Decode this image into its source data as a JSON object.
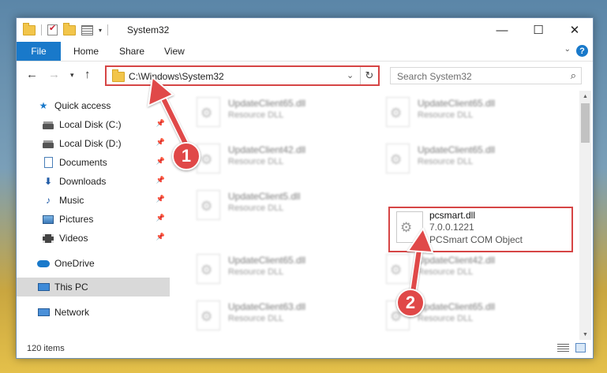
{
  "window": {
    "title": "System32",
    "controls": {
      "minimize": "—",
      "maximize": "☐",
      "close": "✕"
    }
  },
  "ribbon": {
    "tabs": [
      "File",
      "Home",
      "Share",
      "View"
    ],
    "help": "?"
  },
  "address": {
    "path": "C:\\Windows\\System32",
    "search_placeholder": "Search System32"
  },
  "sidebar": {
    "quick_access": "Quick access",
    "items": [
      {
        "label": "Local Disk (C:)",
        "icon": "drive-icon",
        "pinned": true
      },
      {
        "label": "Local Disk (D:)",
        "icon": "drive-icon",
        "pinned": true
      },
      {
        "label": "Documents",
        "icon": "documents-icon",
        "pinned": true
      },
      {
        "label": "Downloads",
        "icon": "downloads-icon",
        "pinned": true
      },
      {
        "label": "Music",
        "icon": "music-icon",
        "pinned": true
      },
      {
        "label": "Pictures",
        "icon": "pictures-icon",
        "pinned": true
      },
      {
        "label": "Videos",
        "icon": "videos-icon",
        "pinned": true
      }
    ],
    "onedrive": "OneDrive",
    "this_pc": "This PC",
    "network": "Network"
  },
  "files": [
    {
      "name": "UpdateClient65.dll",
      "type": "Resource DLL"
    },
    {
      "name": "UpdateClient65.dll",
      "type": "Resource DLL"
    },
    {
      "name": "UpdateClient42.dll",
      "type": "Resource DLL"
    },
    {
      "name": "UpdateClient65.dll",
      "type": "Resource DLL"
    },
    {
      "name": "UpdateClient5.dll",
      "type": "Resource DLL"
    },
    {
      "name": "UpdateClient65.dll",
      "type": "Resource DLL"
    },
    {
      "name": "UpdateClient42.dll",
      "type": "Resource DLL"
    },
    {
      "name": "UpdateClient63.dll",
      "type": "Resource DLL"
    },
    {
      "name": "UpdateClient65.dll",
      "type": "Resource DLL"
    }
  ],
  "highlighted_file": {
    "name": "pcsmart.dll",
    "version": "7.0.0.1221",
    "type": "PCSmart COM Object"
  },
  "status": {
    "item_count": "120 items"
  },
  "annotations": {
    "step1": "1",
    "step2": "2"
  },
  "colors": {
    "accent": "#1979ca",
    "annotation": "#e04848"
  }
}
